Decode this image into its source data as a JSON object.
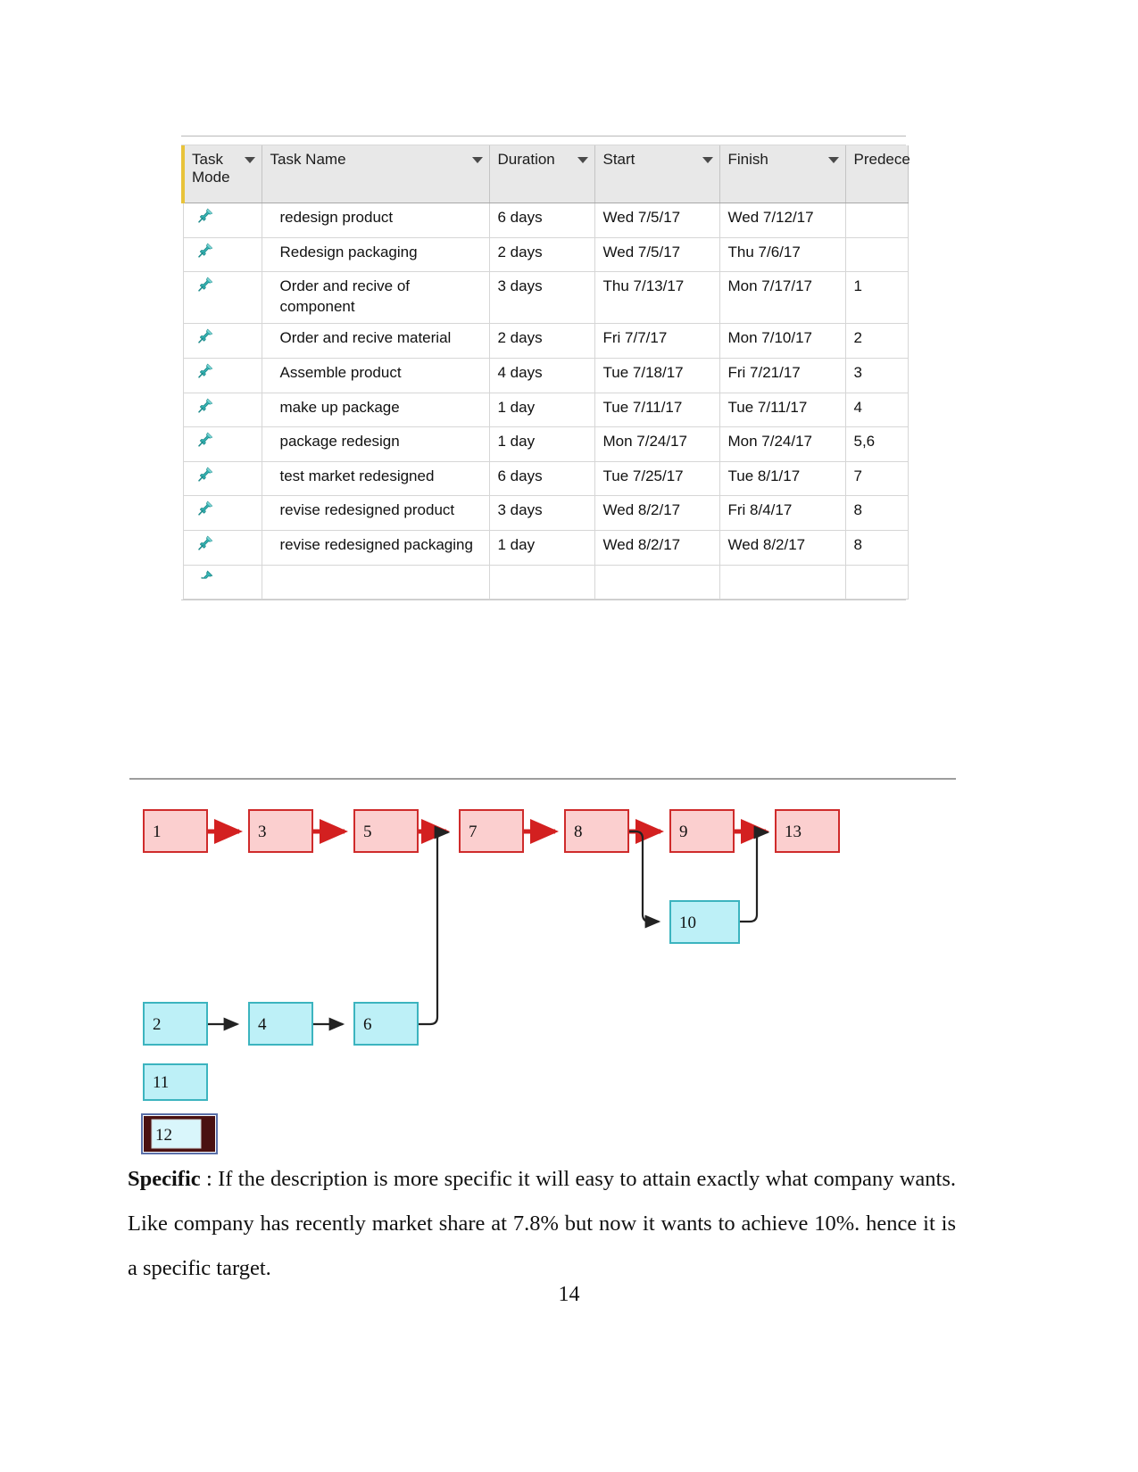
{
  "document": {
    "page_number": "14"
  },
  "project_table": {
    "columns": [
      {
        "key": "mode",
        "label": "Task Mode",
        "has_sort_caret": true
      },
      {
        "key": "name",
        "label": "Task Name",
        "has_sort_caret": true
      },
      {
        "key": "dur",
        "label": "Duration",
        "has_sort_caret": true
      },
      {
        "key": "start",
        "label": "Start",
        "has_sort_caret": true
      },
      {
        "key": "finish",
        "label": "Finish",
        "has_sort_caret": true
      },
      {
        "key": "pred",
        "label": "Predece",
        "has_sort_caret": false
      }
    ],
    "mode_icon": "pushpin-icon",
    "rows": [
      {
        "mode_icon": "pushpin-icon",
        "name": "redesign product",
        "duration": "6 days",
        "start": "Wed 7/5/17",
        "finish": "Wed 7/12/17",
        "predecessors": ""
      },
      {
        "mode_icon": "pushpin-icon",
        "name": "Redesign packaging",
        "duration": "2 days",
        "start": "Wed 7/5/17",
        "finish": "Thu 7/6/17",
        "predecessors": ""
      },
      {
        "mode_icon": "pushpin-icon",
        "name": "Order and recive of component",
        "duration": "3 days",
        "start": "Thu 7/13/17",
        "finish": "Mon 7/17/17",
        "predecessors": "1"
      },
      {
        "mode_icon": "pushpin-icon",
        "name": "Order and recive material",
        "duration": "2 days",
        "start": "Fri 7/7/17",
        "finish": "Mon 7/10/17",
        "predecessors": "2"
      },
      {
        "mode_icon": "pushpin-icon",
        "name": "Assemble product",
        "duration": "4 days",
        "start": "Tue 7/18/17",
        "finish": "Fri 7/21/17",
        "predecessors": "3"
      },
      {
        "mode_icon": "pushpin-icon",
        "name": "make up package",
        "duration": "1 day",
        "start": "Tue 7/11/17",
        "finish": "Tue 7/11/17",
        "predecessors": "4"
      },
      {
        "mode_icon": "pushpin-icon",
        "name": "package redesign",
        "duration": "1 day",
        "start": "Mon 7/24/17",
        "finish": "Mon 7/24/17",
        "predecessors": "5,6"
      },
      {
        "mode_icon": "pushpin-icon",
        "name": "test market redesigned",
        "duration": "6 days",
        "start": "Tue 7/25/17",
        "finish": "Tue 8/1/17",
        "predecessors": "7"
      },
      {
        "mode_icon": "pushpin-icon",
        "name": "revise redesigned product",
        "duration": "3 days",
        "start": "Wed 8/2/17",
        "finish": "Fri 8/4/17",
        "predecessors": "8"
      },
      {
        "mode_icon": "pushpin-icon",
        "name": "revise redesigned packaging",
        "duration": "1 day",
        "start": "Wed 8/2/17",
        "finish": "Wed 8/2/17",
        "predecessors": "8"
      }
    ]
  },
  "network_diagram": {
    "colors": {
      "critical_fill": "#fbcfcf",
      "critical_border": "#cf2b2b",
      "critical_arrow": "#d32020",
      "normal_fill": "#bdf0f7",
      "normal_border": "#3cb4bf",
      "normal_arrow": "#222222",
      "selected_border": "#4a1111"
    },
    "nodes": [
      {
        "id": "1",
        "label": "1",
        "type": "critical",
        "selected": false
      },
      {
        "id": "3",
        "label": "3",
        "type": "critical",
        "selected": false
      },
      {
        "id": "5",
        "label": "5",
        "type": "critical",
        "selected": false
      },
      {
        "id": "7",
        "label": "7",
        "type": "critical",
        "selected": false
      },
      {
        "id": "8",
        "label": "8",
        "type": "critical",
        "selected": false
      },
      {
        "id": "9",
        "label": "9",
        "type": "critical",
        "selected": false
      },
      {
        "id": "13",
        "label": "13",
        "type": "critical",
        "selected": false
      },
      {
        "id": "10",
        "label": "10",
        "type": "normal",
        "selected": false
      },
      {
        "id": "2",
        "label": "2",
        "type": "normal",
        "selected": false
      },
      {
        "id": "4",
        "label": "4",
        "type": "normal",
        "selected": false
      },
      {
        "id": "6",
        "label": "6",
        "type": "normal",
        "selected": false
      },
      {
        "id": "11",
        "label": "11",
        "type": "normal",
        "selected": false
      },
      {
        "id": "12",
        "label": "12",
        "type": "normal",
        "selected": true
      }
    ],
    "edges": [
      {
        "from": "1",
        "to": "3",
        "style": "critical"
      },
      {
        "from": "3",
        "to": "5",
        "style": "critical"
      },
      {
        "from": "5",
        "to": "7",
        "style": "critical"
      },
      {
        "from": "7",
        "to": "8",
        "style": "critical"
      },
      {
        "from": "8",
        "to": "9",
        "style": "critical"
      },
      {
        "from": "9",
        "to": "13",
        "style": "critical"
      },
      {
        "from": "2",
        "to": "4",
        "style": "normal"
      },
      {
        "from": "4",
        "to": "6",
        "style": "normal"
      },
      {
        "from": "6",
        "to": "7",
        "style": "normal"
      },
      {
        "from": "8",
        "to": "10",
        "style": "normal"
      },
      {
        "from": "10",
        "to": "13",
        "style": "normal"
      }
    ]
  },
  "paragraph": {
    "lead_label": "Specific",
    "body": " : If the description is more specific it will easy to attain exactly what company wants. Like company has recently market share at 7.8% but now it wants to achieve 10%. hence it is a specific target."
  }
}
